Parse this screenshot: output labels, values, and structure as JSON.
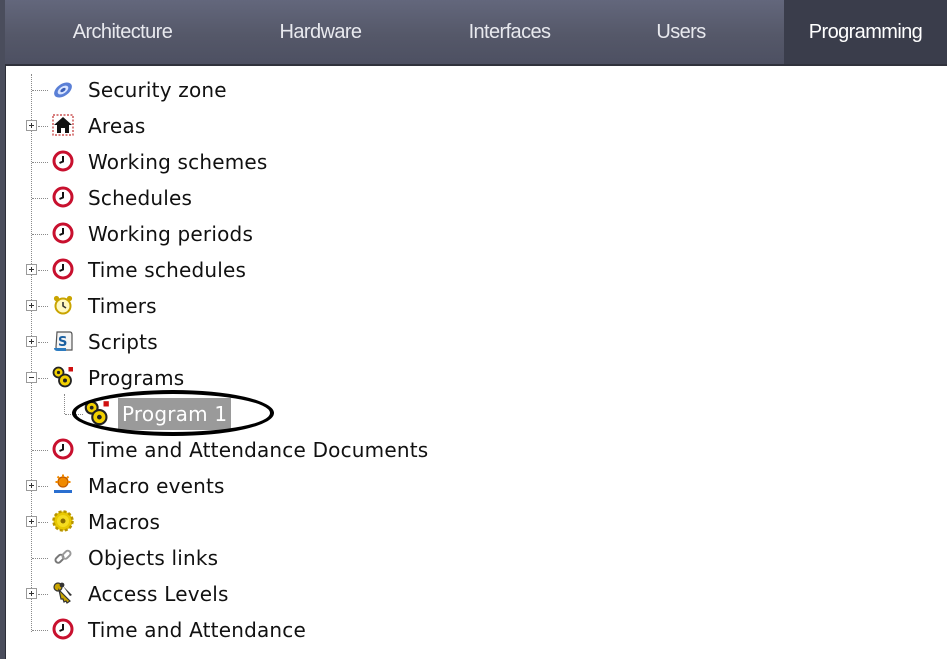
{
  "tabs": [
    {
      "label": "Architecture"
    },
    {
      "label": "Hardware"
    },
    {
      "label": "Interfaces"
    },
    {
      "label": "Users"
    },
    {
      "label": "Programming"
    }
  ],
  "active_tab": "Programming",
  "tree": {
    "items": [
      {
        "label": "Security zone",
        "icon": "security-zone-icon",
        "expander": "none"
      },
      {
        "label": "Areas",
        "icon": "house-icon",
        "expander": "plus"
      },
      {
        "label": "Working schemes",
        "icon": "clock-icon",
        "expander": "none"
      },
      {
        "label": "Schedules",
        "icon": "clock-icon",
        "expander": "none"
      },
      {
        "label": "Working periods",
        "icon": "clock-icon",
        "expander": "none"
      },
      {
        "label": "Time schedules",
        "icon": "clock-icon",
        "expander": "plus"
      },
      {
        "label": "Timers",
        "icon": "alarm-clock-icon",
        "expander": "plus"
      },
      {
        "label": "Scripts",
        "icon": "script-icon",
        "expander": "plus"
      },
      {
        "label": "Programs",
        "icon": "gears-icon",
        "expander": "minus"
      },
      {
        "label": "Program 1",
        "icon": "gears-icon",
        "expander": "none",
        "selected": true
      },
      {
        "label": "Time and Attendance Documents",
        "icon": "clock-icon",
        "expander": "none"
      },
      {
        "label": "Macro events",
        "icon": "macro-event-icon",
        "expander": "plus"
      },
      {
        "label": "Macros",
        "icon": "gear-icon",
        "expander": "plus"
      },
      {
        "label": "Objects links",
        "icon": "link-icon",
        "expander": "none"
      },
      {
        "label": "Access Levels",
        "icon": "keys-icon",
        "expander": "plus"
      },
      {
        "label": "Time and Attendance",
        "icon": "clock-icon",
        "expander": "none"
      }
    ]
  },
  "colors": {
    "tab_bar": "#555869",
    "active_tab": "#3a3d4b",
    "selection": "#9a9a9a",
    "clock_red": "#c8102e"
  }
}
